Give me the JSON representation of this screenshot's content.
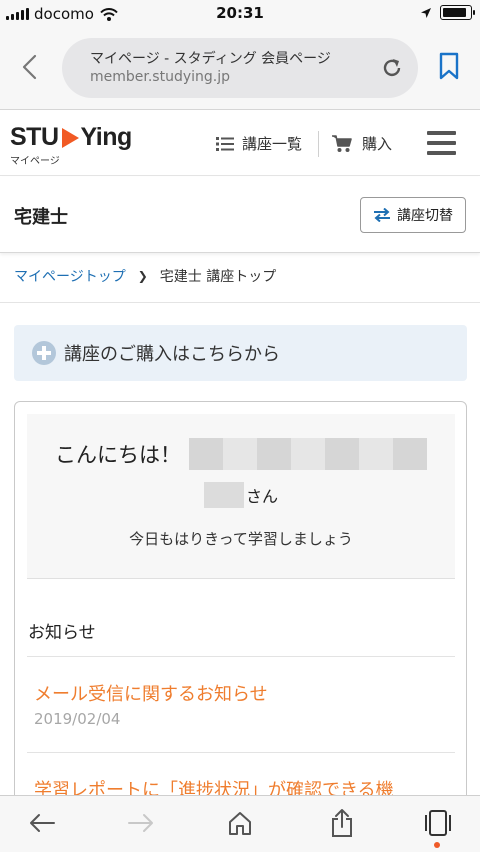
{
  "status_bar": {
    "carrier": "docomo",
    "time": "20:31",
    "battery_level": 0.9
  },
  "browser": {
    "page_title": "マイページ - スタディング 会員ページ",
    "host": "member.studying.jp",
    "icons": [
      "back-icon",
      "reload-icon",
      "bookmark-icon"
    ]
  },
  "header": {
    "logo_text_left": "STU",
    "logo_text_right": "Ying",
    "logo_sub": "マイページ",
    "nav_courses": "講座一覧",
    "nav_purchase": "購入"
  },
  "course_bar": {
    "course_name": "宅建士",
    "switch_label": "講座切替"
  },
  "breadcrumb": {
    "home": "マイページトップ",
    "current": "宅建士 講座トップ"
  },
  "purchase_banner": {
    "text": "講座のご購入はこちらから"
  },
  "welcome": {
    "greeting": "こんにちは！",
    "honorific": "さん",
    "motto": "今日もはりきって学習しましょう"
  },
  "news": {
    "heading": "お知らせ",
    "items": [
      {
        "title": "メール受信に関するお知らせ",
        "date": "2019/02/04"
      },
      {
        "title": "学習レポートに「進捗状況」が確認できる機"
      }
    ]
  },
  "colors": {
    "accent_orange": "#ef7d2e",
    "link_blue": "#1e6fb3",
    "logo_play_orange": "#f15a24",
    "banner_bg": "#eaf1f8",
    "bookmark_blue": "#1a73c8"
  },
  "toolbar_icons": [
    "back-arrow-icon",
    "forward-arrow-icon",
    "home-icon",
    "share-icon",
    "tabs-icon"
  ]
}
